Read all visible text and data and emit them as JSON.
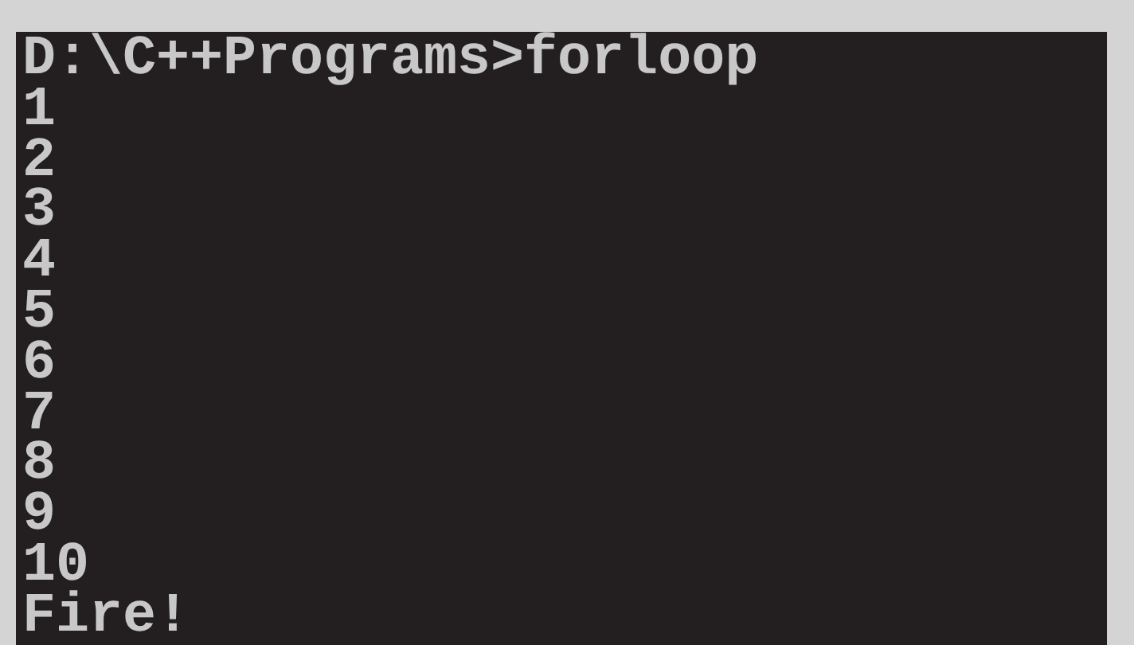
{
  "console": {
    "lines": [
      "D:\\C++Programs>forloop",
      "1",
      "2",
      "3",
      "4",
      "5",
      "6",
      "7",
      "8",
      "9",
      "10",
      "Fire!"
    ]
  }
}
